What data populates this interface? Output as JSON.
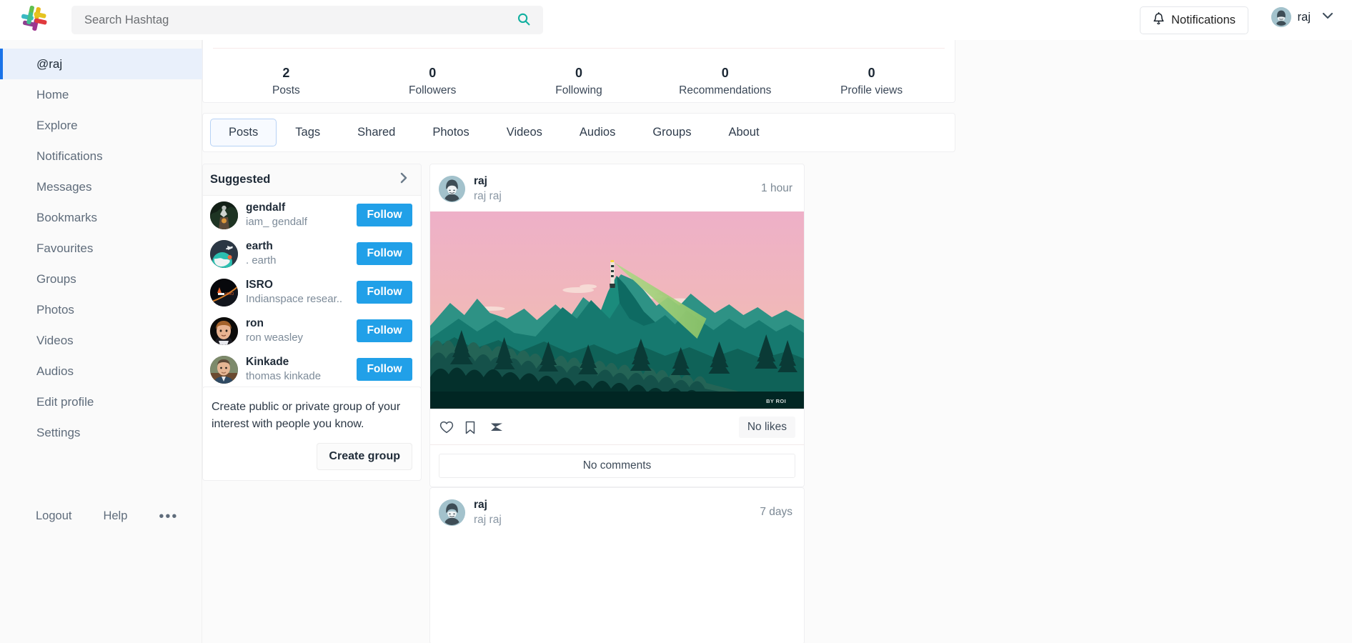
{
  "header": {
    "logo_icon": "hashtag-logo",
    "search": {
      "placeholder": "Search Hashtag",
      "value": "",
      "icon": "search-icon"
    },
    "notifications_label": "Notifications",
    "notifications_icon": "bell-icon",
    "user_name": "raj",
    "user_avatar_icon": "anonymous-avatar",
    "chevron_icon": "chevron-down-icon"
  },
  "sidebar": {
    "items": [
      {
        "label": "@raj",
        "active": true
      },
      {
        "label": "Home",
        "active": false
      },
      {
        "label": "Explore",
        "active": false
      },
      {
        "label": "Notifications",
        "active": false
      },
      {
        "label": "Messages",
        "active": false
      },
      {
        "label": "Bookmarks",
        "active": false
      },
      {
        "label": "Favourites",
        "active": false
      },
      {
        "label": "Groups",
        "active": false
      },
      {
        "label": "Photos",
        "active": false
      },
      {
        "label": "Videos",
        "active": false
      },
      {
        "label": "Audios",
        "active": false
      },
      {
        "label": "Edit profile",
        "active": false
      },
      {
        "label": "Settings",
        "active": false
      }
    ],
    "footer": {
      "logout": "Logout",
      "help": "Help",
      "more": "•••"
    }
  },
  "stats": [
    {
      "value": "2",
      "label": "Posts"
    },
    {
      "value": "0",
      "label": "Followers"
    },
    {
      "value": "0",
      "label": "Following"
    },
    {
      "value": "0",
      "label": "Recommendations"
    },
    {
      "value": "0",
      "label": "Profile views"
    }
  ],
  "tabs": [
    {
      "label": "Posts",
      "active": true
    },
    {
      "label": "Tags",
      "active": false
    },
    {
      "label": "Shared",
      "active": false
    },
    {
      "label": "Photos",
      "active": false
    },
    {
      "label": "Videos",
      "active": false
    },
    {
      "label": "Audios",
      "active": false
    },
    {
      "label": "Groups",
      "active": false
    },
    {
      "label": "About",
      "active": false
    }
  ],
  "suggested": {
    "title": "Suggested",
    "chevron_icon": "chevron-right-icon",
    "follow_label": "Follow",
    "people": [
      {
        "name": "gendalf",
        "handle": "iam_ gendalf",
        "avatar": "wizard-avatar"
      },
      {
        "name": "earth",
        "handle": ". earth",
        "avatar": "earth-avatar"
      },
      {
        "name": "ISRO",
        "handle": "Indianspace resear..",
        "avatar": "isro-avatar"
      },
      {
        "name": "ron",
        "handle": "ron weasley",
        "avatar": "boy-avatar"
      },
      {
        "name": "Kinkade",
        "handle": "thomas kinkade",
        "avatar": "man-avatar"
      }
    ]
  },
  "create_group": {
    "text": "Create public or private group of your interest with people you know.",
    "button_label": "Create group"
  },
  "posts": [
    {
      "author": "raj",
      "author_full": "raj raj",
      "time": "1 hour",
      "avatar_icon": "anonymous-avatar",
      "media": {
        "kind": "illustration",
        "alt": "flat-design mountain forest landscape at sunset with lighthouse beam",
        "watermark": "BY ROI",
        "sky_top": "#eeaec6",
        "sky_bottom": "#f5bda2",
        "mountain_far": "#2e8f80",
        "mountain_mid": "#17786f",
        "mountain_near": "#0f6c62",
        "forest_far": "#27695c",
        "forest_mid": "#10463f",
        "forest_near": "#052b28",
        "forest_front": "#00221f",
        "beam": "#90c46a"
      },
      "actions": {
        "like_icon": "heart-icon",
        "bookmark_icon": "bookmark-icon",
        "share_icon": "send-icon"
      },
      "likes_text": "No likes",
      "comments_text": "No comments"
    },
    {
      "author": "raj",
      "author_full": "raj raj",
      "time": "7 days",
      "avatar_icon": "anonymous-avatar"
    }
  ],
  "colors": {
    "accent_blue": "#1a73e8",
    "follow_blue": "#21a0e8",
    "search_teal": "#12b0a0",
    "page_bg": "#fbfbfb",
    "sidebar_bg": "#fafafa"
  }
}
